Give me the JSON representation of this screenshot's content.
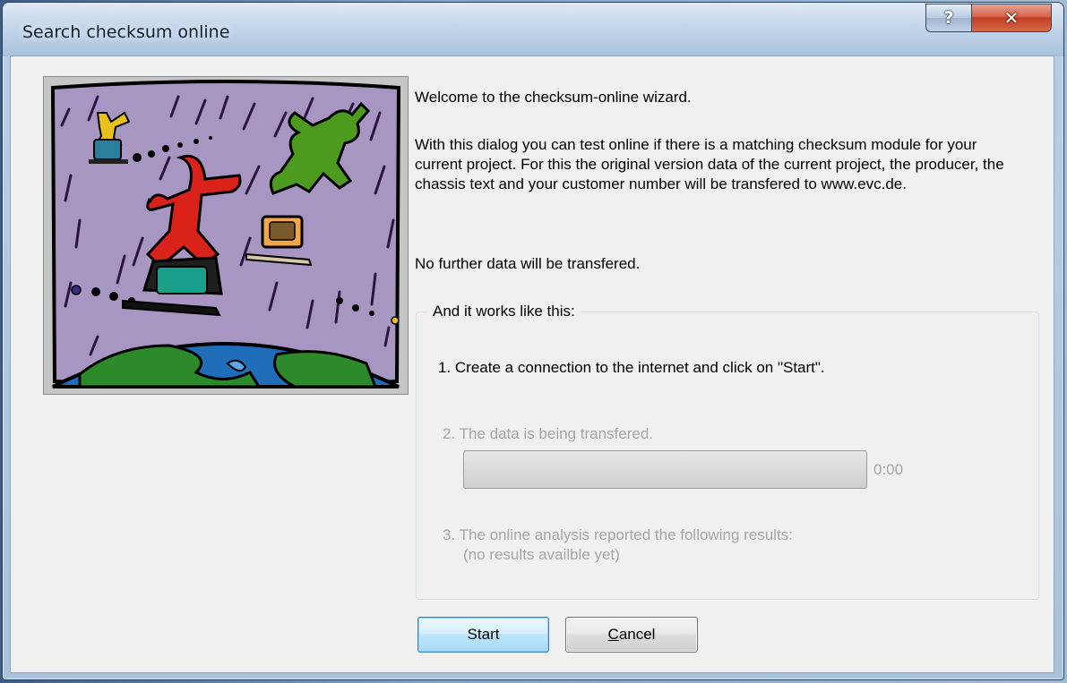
{
  "window": {
    "title": "Search checksum online",
    "help_glyph": "?",
    "close_glyph": "✕"
  },
  "content": {
    "welcome": "Welcome to the checksum-online wizard.",
    "description": "With this dialog you can test online if there is a matching checksum module for your current project. For this the original version data of the current project, the producer, the chassis text and your customer number will be transfered to www.evc.de.",
    "no_further": "No further data will be transfered."
  },
  "steps_group": {
    "legend": "And it works like this:",
    "step1": "1. Create a connection to the internet and click on \"Start\".",
    "step2": "2. The data is being transfered.",
    "progress_fraction": 0,
    "timer": "0:00",
    "step3": "3. The online analysis reported the following results:",
    "results": "(no results availble yet)"
  },
  "buttons": {
    "start": "Start",
    "cancel_mnemonic": "C",
    "cancel_rest": "ancel"
  },
  "icons": {
    "illustration": "people-surfing-computers-over-globe-illustration",
    "help": "help-icon",
    "close": "close-icon"
  },
  "colors": {
    "illustration_sky": "#a796c2",
    "disabled_text": "#a6a6a6"
  }
}
